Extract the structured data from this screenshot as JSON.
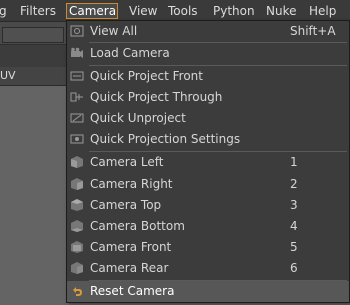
{
  "menubar": {
    "items": [
      {
        "label": "g"
      },
      {
        "label": "Filters"
      },
      {
        "label": "Camera"
      },
      {
        "label": "View"
      },
      {
        "label": "Tools"
      },
      {
        "label": "Python"
      },
      {
        "label": "Nuke"
      },
      {
        "label": "Help"
      }
    ]
  },
  "left_panel": {
    "uv_label": "UV"
  },
  "camera_menu": {
    "items": [
      {
        "label": "View All",
        "shortcut": "Shift+A",
        "icon": "view-all-icon"
      },
      {
        "label": "Load Camera",
        "icon": "load-camera-icon"
      },
      {
        "label": "Quick Project Front",
        "icon": "project-front-icon"
      },
      {
        "label": "Quick Project Through",
        "icon": "project-through-icon"
      },
      {
        "label": "Quick Unproject",
        "icon": "unproject-icon"
      },
      {
        "label": "Quick Projection Settings",
        "icon": "projection-settings-icon"
      },
      {
        "label": "Camera Left",
        "shortcut": "1",
        "icon": "cube-icon"
      },
      {
        "label": "Camera Right",
        "shortcut": "2",
        "icon": "cube-icon"
      },
      {
        "label": "Camera Top",
        "shortcut": "3",
        "icon": "cube-icon"
      },
      {
        "label": "Camera Bottom",
        "shortcut": "4",
        "icon": "cube-icon"
      },
      {
        "label": "Camera Front",
        "shortcut": "5",
        "icon": "cube-icon"
      },
      {
        "label": "Camera Rear",
        "shortcut": "6",
        "icon": "cube-icon"
      },
      {
        "label": "Reset Camera",
        "icon": "reset-arrow-icon"
      }
    ]
  },
  "colors": {
    "active_border": "#d08a2a",
    "highlight": "#575757",
    "reset_icon": "#d89a3a"
  }
}
